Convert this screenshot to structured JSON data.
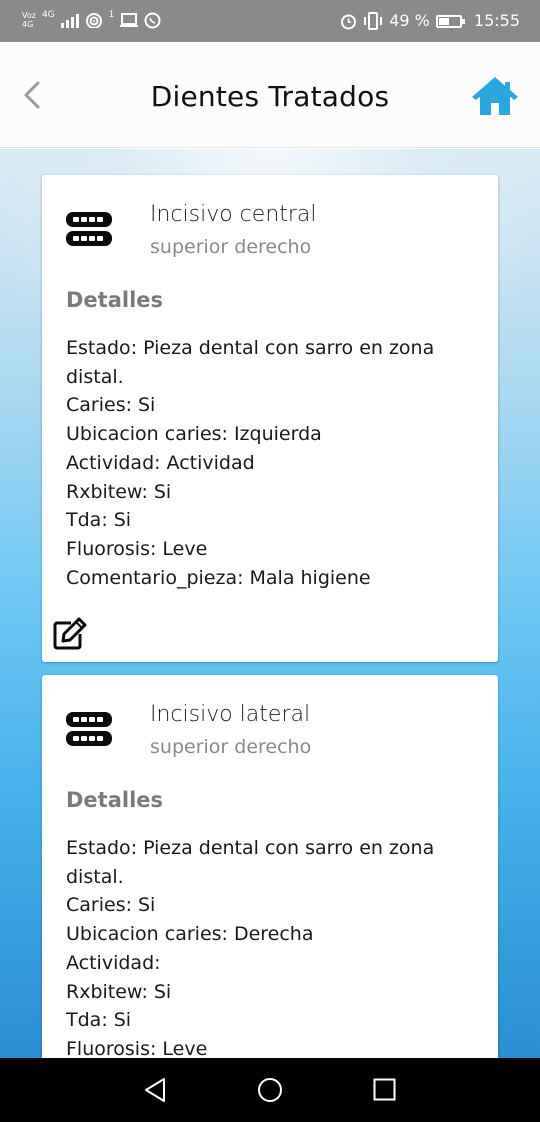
{
  "status_bar": {
    "voz": "Voz",
    "net": "4G",
    "net2": "4G",
    "sub": "1",
    "battery_text": "49 %",
    "battery_level": 0.49,
    "time": "15:55",
    "icons": [
      "signal-icon",
      "wifi-icon",
      "monitor-icon",
      "whatsapp-icon",
      "alarm-icon",
      "vibrate-icon",
      "battery-icon"
    ]
  },
  "app_bar": {
    "title": "Dientes Tratados",
    "back_icon": "chevron-left-icon",
    "home_icon": "home-icon"
  },
  "colors": {
    "accent": "#2aa7df",
    "gradient_top": "#d7e9f4",
    "gradient_bottom": "#2b8fd3"
  },
  "cards": [
    {
      "title": "Incisivo central",
      "subtitle": "superior derecho",
      "section": "Detalles",
      "fields": [
        {
          "label": "Estado",
          "value": "Pieza dental con sarro en zona distal."
        },
        {
          "label": "Caries",
          "value": "Si"
        },
        {
          "label": "Ubicacion caries",
          "value": "Izquierda"
        },
        {
          "label": "Actividad",
          "value": "Actividad"
        },
        {
          "label": "Rxbitew",
          "value": "Si"
        },
        {
          "label": "Tda",
          "value": "Si"
        },
        {
          "label": "Fluorosis",
          "value": "Leve"
        },
        {
          "label": "Comentario_pieza",
          "value": "Mala higiene"
        }
      ]
    },
    {
      "title": "Incisivo lateral",
      "subtitle": "superior derecho",
      "section": "Detalles",
      "fields": [
        {
          "label": "Estado",
          "value": "Pieza dental con sarro en zona distal."
        },
        {
          "label": "Caries",
          "value": "Si"
        },
        {
          "label": "Ubicacion caries",
          "value": "Derecha"
        },
        {
          "label": "Actividad",
          "value": ""
        },
        {
          "label": "Rxbitew",
          "value": "Si"
        },
        {
          "label": "Tda",
          "value": "Si"
        },
        {
          "label": "Fluorosis",
          "value": "Leve"
        }
      ]
    }
  ]
}
